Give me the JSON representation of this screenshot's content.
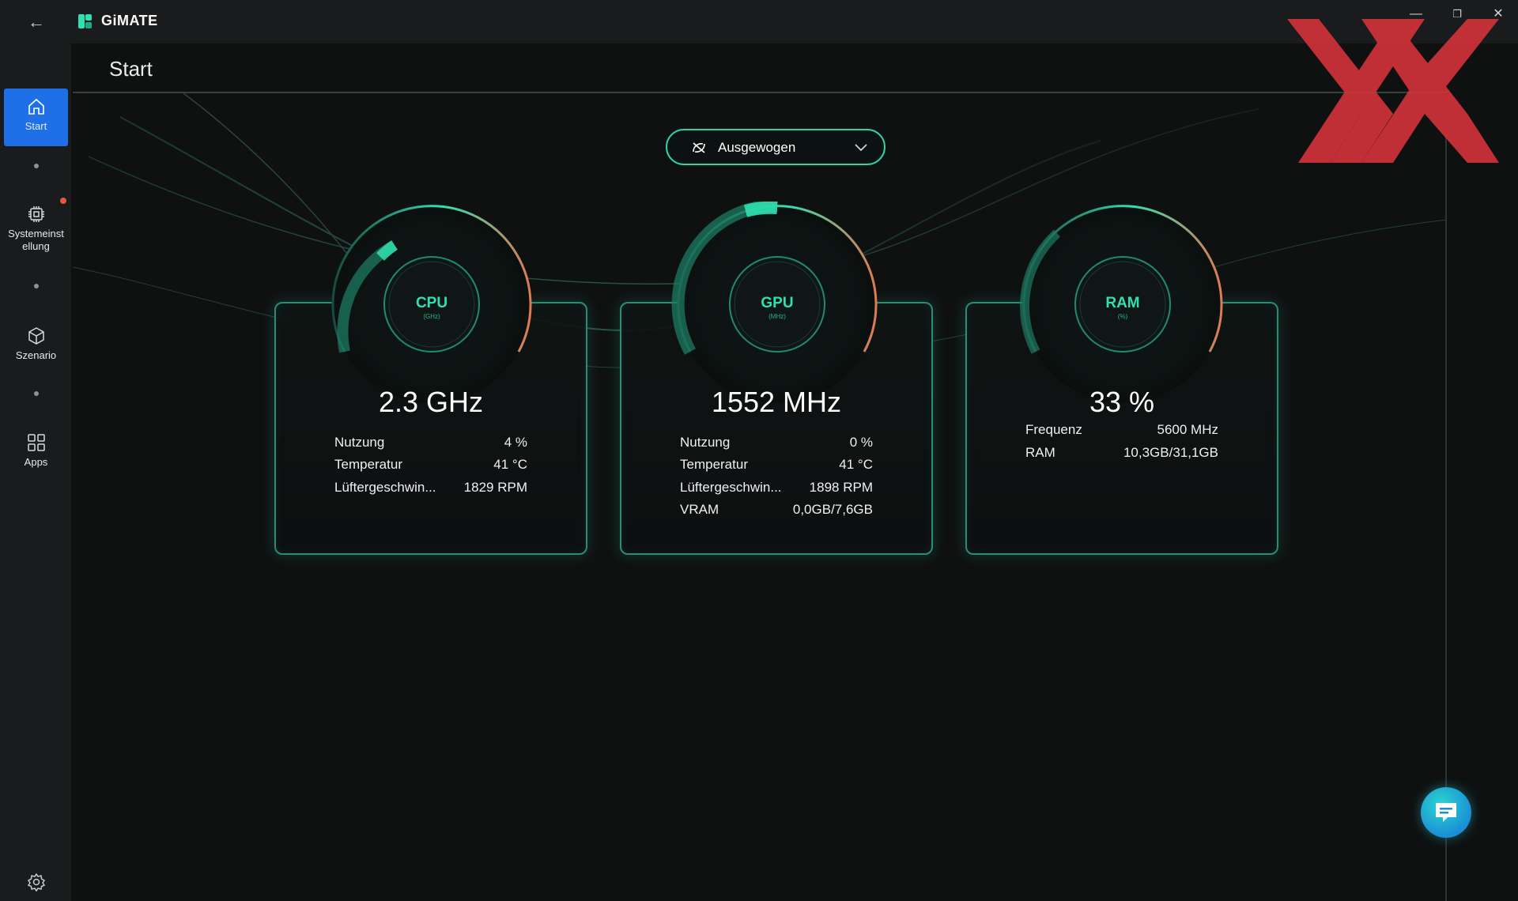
{
  "app": {
    "title": "GiMATE",
    "logo_icon": "gimate-logo-icon",
    "back_icon": "back-arrow-icon",
    "window_controls": [
      "minimize-icon",
      "maximize-icon",
      "close-icon"
    ],
    "controls_glyphs": {
      "minimize": "—",
      "maximize": "❐",
      "close": "✕"
    }
  },
  "sidebar": {
    "items": [
      {
        "label": "Start",
        "icon": "home-icon",
        "active": true
      },
      {
        "label": "Systemeinst ellung",
        "icon": "chip-icon",
        "badge": true
      },
      {
        "label": "Szenario",
        "icon": "cube-icon"
      },
      {
        "label": "Apps",
        "icon": "grid-icon"
      }
    ],
    "settings_icon": "gear-icon"
  },
  "page": {
    "title": "Start"
  },
  "mode_select": {
    "value": "Ausgewogen",
    "icon": "balance-mode-icon"
  },
  "cards": {
    "cpu": {
      "gauge_name": "CPU",
      "gauge_unit": "(GHz)",
      "value": "2.3 GHz",
      "rows": [
        {
          "key": "Nutzung",
          "value": "4 %"
        },
        {
          "key": "Temperatur",
          "value": "41 °C"
        },
        {
          "key": "Lüftergeschwin...",
          "value": "1829 RPM"
        }
      ]
    },
    "gpu": {
      "gauge_name": "GPU",
      "gauge_unit": "(MHz)",
      "value": "1552 MHz",
      "rows": [
        {
          "key": "Nutzung",
          "value": "0 %"
        },
        {
          "key": "Temperatur",
          "value": "41 °C"
        },
        {
          "key": "Lüftergeschwin...",
          "value": "1898 RPM"
        },
        {
          "key": "VRAM",
          "value": "0,0GB/7,6GB"
        }
      ]
    },
    "ram": {
      "gauge_name": "RAM",
      "gauge_unit": "(%)",
      "value": "33 %",
      "rows": [
        {
          "key": "Frequenz",
          "value": "5600 MHz"
        },
        {
          "key": "RAM",
          "value": "10,3GB/31,1GB"
        }
      ]
    }
  },
  "colors": {
    "accent": "#2fe0b0",
    "sidebar_active": "#1f6fe6",
    "gauge_hot": "#e07a52",
    "watermark": "#d9343a"
  },
  "chat": {
    "icon": "chat-bubble-icon"
  }
}
